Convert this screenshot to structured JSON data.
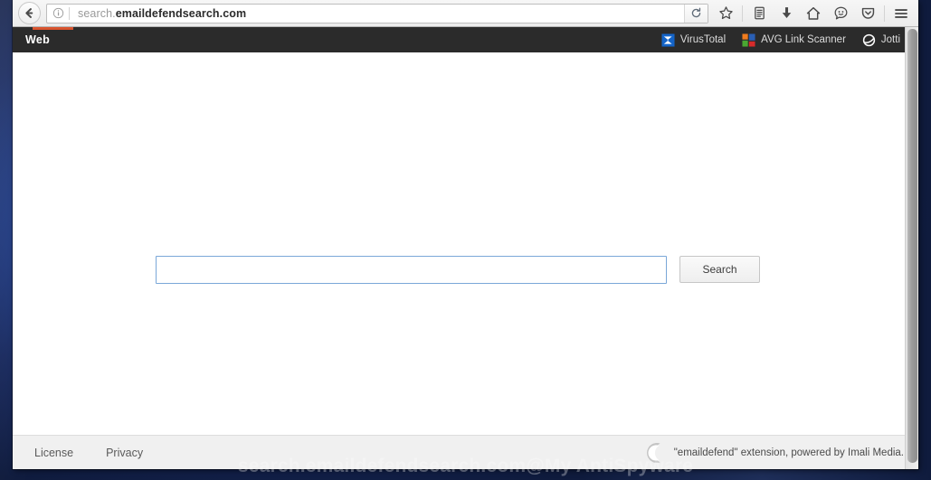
{
  "browser": {
    "back_button": "back-arrow",
    "identity_icon": "info-circle-icon",
    "url_prefix": "search.",
    "url_domain": "emaildefendsearch.com",
    "url_full": "search.emaildefendsearch.com",
    "reload_label": "reload-icon",
    "toolbar_icons": [
      {
        "name": "bookmark-star-icon",
        "glyph": "star"
      },
      {
        "name": "reading-list-icon",
        "glyph": "list"
      },
      {
        "name": "downloads-icon",
        "glyph": "down-arrow"
      },
      {
        "name": "home-icon",
        "glyph": "home"
      },
      {
        "name": "hello-smiley-icon",
        "glyph": "smiley"
      },
      {
        "name": "pocket-icon",
        "glyph": "shield-check"
      },
      {
        "name": "menu-icon",
        "glyph": "hamburger"
      }
    ]
  },
  "site_header": {
    "tab_label": "Web",
    "accent_color": "#d9542e",
    "background_color": "#2b2b2b",
    "scan_links": [
      {
        "label": "VirusTotal",
        "icon": "virustotal-icon"
      },
      {
        "label": "AVG Link Scanner",
        "icon": "avg-icon"
      },
      {
        "label": "Jotti",
        "icon": "jotti-icon"
      }
    ]
  },
  "search": {
    "value": "",
    "placeholder": "",
    "button_label": "Search",
    "border_color": "#7aa7d8"
  },
  "footer": {
    "links": [
      {
        "label": "License"
      },
      {
        "label": "Privacy"
      }
    ],
    "logo_icon": "crescent-moon-icon",
    "credit": "\"emaildefend\" extension, powered by Imali Media."
  },
  "watermark": {
    "text": "search.emaildefendsearch.com@My AntiSpyware"
  },
  "desktop": {
    "background_color": "#16275c"
  }
}
